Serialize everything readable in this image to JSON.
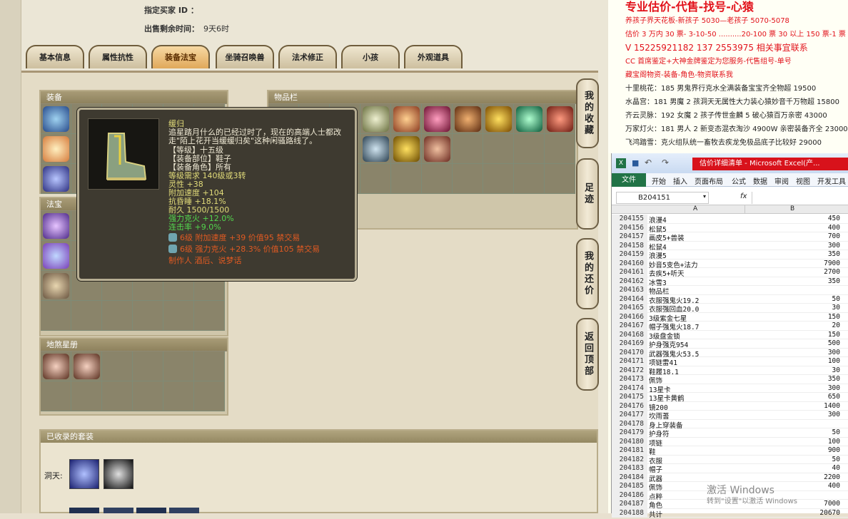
{
  "seller": {
    "buyer_label": "指定买家 ID ：",
    "buyer_value": "",
    "time_label": "出售剩余时间：",
    "time_value": "9天6时"
  },
  "tabs": [
    "基本信息",
    "属性抗性",
    "装备法宝",
    "坐骑召唤兽",
    "法术修正",
    "小孩",
    "外观道具"
  ],
  "active_tab": "装备法宝",
  "sections": {
    "equip": "装备",
    "treasure": "法宝",
    "item_bar": "物品栏",
    "star": "地煞星册",
    "sets": "已收录的套装",
    "dongtian": "洞天:"
  },
  "side_buttons": [
    "我的收藏",
    "足迹",
    "我的还价",
    "返回顶部"
  ],
  "tooltip": {
    "name": "缓归",
    "desc1": "追星踏月什么的已经过时了，现在的高端人士都改",
    "desc2": "走\"陌上花开当缓缓归矣\"这种闲骚路线了。",
    "level": "【等级】十五级",
    "slot": "【装备部位】鞋子",
    "role": "【装备角色】所有",
    "req": "等级需求 140级或3转",
    "lingxing": "灵性 +38",
    "speed": "附加速度 +104",
    "resist": "抗昏睡 +18.1%",
    "dura": "耐久 1500/1500",
    "restrain": "强力克火 +12.0%",
    "combo": "连击率 +9.0%",
    "gem1": "6级 附加速度 +39 价值95 禁交易",
    "gem2": "6级 强力克火 +28.3% 价值105 禁交易",
    "maker": "制作人 酒后、说梦话"
  },
  "ad": [
    {
      "t": "专业估价-代售-找号-心猿",
      "c": "red",
      "s": "big"
    },
    {
      "t": "养孩子界天花板-新孩子 5030—老孩子 5070-5078",
      "c": "red"
    },
    {
      "t": "估价 3 万内 30 票- 3-10-50 ..........20-100 票 30 以上 150 票-1 票",
      "c": "red"
    },
    {
      "t": "V 15225921182     137 2553975   相关事宜联系",
      "c": "red",
      "s": "mid"
    },
    {
      "t": "CC 首席鉴定+大神金牌鉴定为您服务-代售组号-单号",
      "c": "red"
    },
    {
      "t": "藏宝阁物资-装备-角色-物资联系我",
      "c": "red"
    },
    {
      "t": "十里桃花：185 男鬼界行克水全满装备宝宝齐全物超 19500",
      "c": "black"
    },
    {
      "t": "水晶宫：181 男魔 2 孩洞天无属性大力装心猿妙音千万物超 15800",
      "c": "black"
    },
    {
      "t": "齐云灵脉：192 女魔 2 孩子传世金麟 5 破心猿百万亲密 43000",
      "c": "black"
    },
    {
      "t": "万家灯火：181 男人 2 新变态混衣淘沙 4900W 亲密装备齐全 23000",
      "c": "black"
    },
    {
      "t": "飞鸿踏雪：克火组队统一畜牧去疾龙免极品底子比较好 29000",
      "c": "black"
    }
  ],
  "excel": {
    "title": "估价详细清单 - Microsoft Excel(产...",
    "file": "文件",
    "menu": [
      "开始",
      "插入",
      "页面布局",
      "公式",
      "数据",
      "审阅",
      "视图",
      "开发工具"
    ],
    "namebox": "B204151",
    "fx": "fx",
    "col_a": "A",
    "col_b": "B",
    "rows": [
      [
        "204155",
        "浪漫4",
        "450"
      ],
      [
        "204156",
        "松鼠5",
        "400"
      ],
      [
        "204157",
        "画皮5+兽装",
        "700"
      ],
      [
        "204158",
        "松鼠4",
        "300"
      ],
      [
        "204159",
        "浪漫5",
        "350"
      ],
      [
        "204160",
        "妙音5变色+法力",
        "7900"
      ],
      [
        "204161",
        "去疾5+听天",
        "2700"
      ],
      [
        "204162",
        "冰雪3",
        "350"
      ],
      [
        "204163",
        "物品栏",
        ""
      ],
      [
        "204164",
        "衣服强鬼火19.2",
        "50"
      ],
      [
        "204165",
        "衣服强回血20.0",
        "30"
      ],
      [
        "204166",
        "3级紫金七星",
        "150"
      ],
      [
        "204167",
        "帽子强鬼火18.7",
        "20"
      ],
      [
        "204168",
        "3级盘金锁",
        "150"
      ],
      [
        "204169",
        "护身强克954",
        "500"
      ],
      [
        "204170",
        "武器强鬼火53.5",
        "300"
      ],
      [
        "204171",
        "项链雷41",
        "100"
      ],
      [
        "204172",
        "鞋履18.1",
        "30"
      ],
      [
        "204173",
        "佩饰",
        "350"
      ],
      [
        "204174",
        "13星卡",
        "300"
      ],
      [
        "204175",
        "13星卡黄鹤",
        "650"
      ],
      [
        "204176",
        "镜200",
        "1400"
      ],
      [
        "204177",
        "坎雨蓍",
        "300"
      ],
      [
        "204178",
        "身上穿装备",
        ""
      ],
      [
        "204179",
        "护身符",
        "50"
      ],
      [
        "204180",
        "项链",
        "100"
      ],
      [
        "204181",
        "鞋",
        "900"
      ],
      [
        "204182",
        "衣服",
        "50"
      ],
      [
        "204183",
        "帽子",
        "40"
      ],
      [
        "204184",
        "武器",
        "2200"
      ],
      [
        "204185",
        "佩饰",
        "400"
      ],
      [
        "204186",
        "点粹",
        ""
      ],
      [
        "204187",
        "角色",
        "7000"
      ],
      [
        "204188",
        "共计",
        "20670"
      ]
    ]
  },
  "watermark": {
    "l1": "激活 Windows",
    "l2": "转到\"设置\"以激活 Windows"
  },
  "colors": {
    "accent": "#e2121b",
    "excel_green": "#217346"
  }
}
